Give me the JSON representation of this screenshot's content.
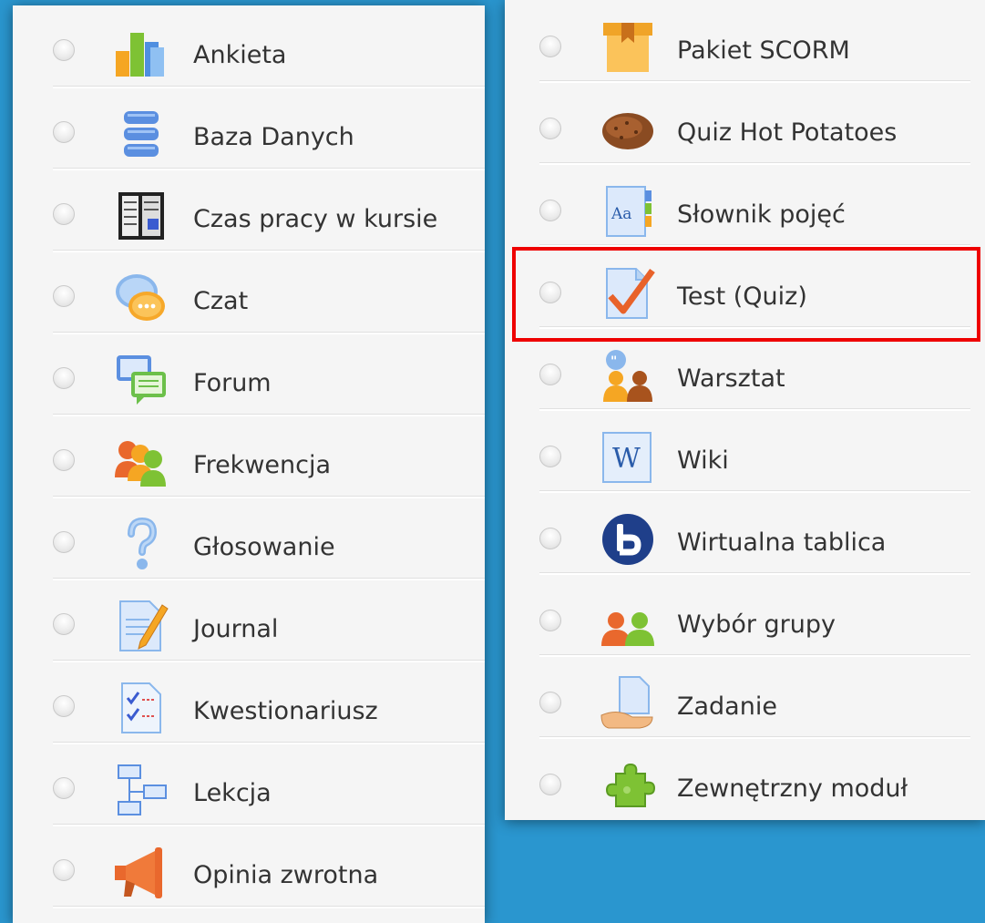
{
  "left_column": {
    "items": [
      {
        "label": "Ankieta",
        "icon": "chart-bars-icon"
      },
      {
        "label": "Baza Danych",
        "icon": "database-icon"
      },
      {
        "label": "Czas pracy w kursie",
        "icon": "time-report-icon"
      },
      {
        "label": "Czat",
        "icon": "chat-bubble-icon"
      },
      {
        "label": "Forum",
        "icon": "forum-icon"
      },
      {
        "label": "Frekwencja",
        "icon": "people-group-icon"
      },
      {
        "label": "Głosowanie",
        "icon": "question-mark-icon"
      },
      {
        "label": "Journal",
        "icon": "journal-pencil-icon"
      },
      {
        "label": "Kwestionariusz",
        "icon": "checklist-icon"
      },
      {
        "label": "Lekcja",
        "icon": "flowchart-icon"
      },
      {
        "label": "Opinia zwrotna",
        "icon": "megaphone-icon"
      }
    ]
  },
  "right_column": {
    "items": [
      {
        "label": "Pakiet SCORM",
        "icon": "package-box-icon"
      },
      {
        "label": "Quiz Hot Potatoes",
        "icon": "potato-icon"
      },
      {
        "label": "Słownik pojęć",
        "icon": "glossary-book-icon"
      },
      {
        "label": "Test (Quiz)",
        "icon": "quiz-check-icon",
        "highlighted": true
      },
      {
        "label": "Warsztat",
        "icon": "workshop-people-icon"
      },
      {
        "label": "Wiki",
        "icon": "wiki-w-icon"
      },
      {
        "label": "Wirtualna tablica",
        "icon": "bigbluebutton-icon"
      },
      {
        "label": "Wybór grupy",
        "icon": "group-choice-icon"
      },
      {
        "label": "Zadanie",
        "icon": "assignment-hand-icon"
      },
      {
        "label": "Zewnętrzny moduł",
        "icon": "puzzle-piece-icon"
      }
    ]
  },
  "colors": {
    "background": "#2a96cf",
    "panel": "#f5f5f5",
    "highlight_border": "#ee0000",
    "label_text": "#333333"
  }
}
